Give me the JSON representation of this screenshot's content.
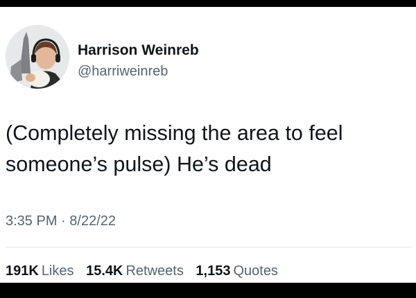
{
  "tweet": {
    "author": {
      "name": "Harrison Weinreb",
      "handle": "@harriweinreb"
    },
    "text_lines": [
      "(Completely missing the area to feel",
      "someone’s pulse) He’s dead"
    ],
    "time": "3:35 PM",
    "separator": "·",
    "date": "8/22/22",
    "stats": {
      "likes": {
        "count": "191K",
        "label": "Likes"
      },
      "retweets": {
        "count": "15.4K",
        "label": "Retweets"
      },
      "quotes": {
        "count": "1,153",
        "label": "Quotes"
      }
    }
  }
}
